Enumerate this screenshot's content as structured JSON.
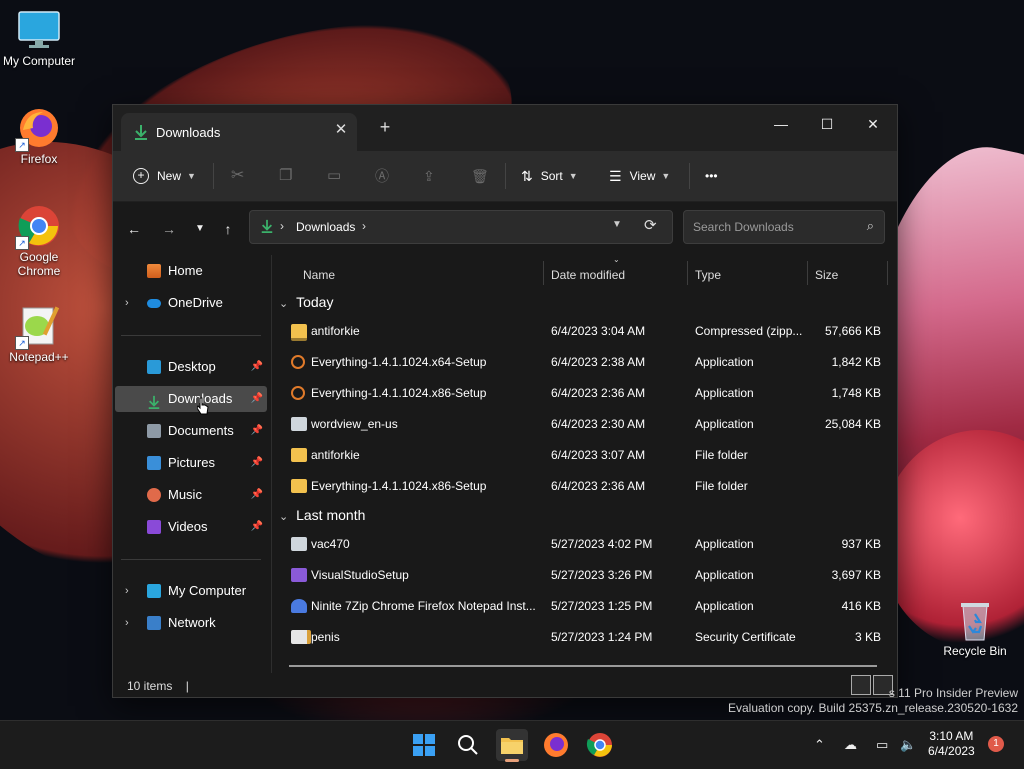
{
  "desktop": {
    "icons": [
      {
        "label": "My Computer"
      },
      {
        "label": "Firefox"
      },
      {
        "label": "Google Chrome"
      },
      {
        "label": "Notepad++"
      },
      {
        "label": "Recycle Bin"
      }
    ],
    "watermark_line1": "s 11 Pro Insider Preview",
    "watermark_line2": "Evaluation copy. Build 25375.zn_release.230520-1632"
  },
  "window": {
    "tab_title": "Downloads",
    "tab_close": "✕",
    "new_tab": "+",
    "controls": {
      "minimize": "—",
      "maximize": "☐",
      "close": "✕"
    },
    "commandbar": {
      "new_label": "New",
      "sort_label": "Sort",
      "view_label": "View",
      "more_label": "•••"
    },
    "address": {
      "path": "Downloads",
      "search_placeholder": "Search Downloads"
    },
    "sidebar": {
      "home": "Home",
      "onedrive": "OneDrive",
      "desktop": "Desktop",
      "downloads": "Downloads",
      "documents": "Documents",
      "pictures": "Pictures",
      "music": "Music",
      "videos": "Videos",
      "my_computer": "My Computer",
      "network": "Network"
    },
    "columns": {
      "name": "Name",
      "date": "Date modified",
      "type": "Type",
      "size": "Size"
    },
    "groups": {
      "today": "Today",
      "last_month": "Last month"
    },
    "files_today": [
      {
        "name": "antiforkie",
        "date": "6/4/2023 3:04 AM",
        "type": "Compressed (zipp...",
        "size": "57,666 KB",
        "icon": "zip-folder-icon"
      },
      {
        "name": "Everything-1.4.1.1024.x64-Setup",
        "date": "6/4/2023 2:38 AM",
        "type": "Application",
        "size": "1,842 KB",
        "icon": "everything-app-icon"
      },
      {
        "name": "Everything-1.4.1.1024.x86-Setup",
        "date": "6/4/2023 2:36 AM",
        "type": "Application",
        "size": "1,748 KB",
        "icon": "everything-app-icon"
      },
      {
        "name": "wordview_en-us",
        "date": "6/4/2023 2:30 AM",
        "type": "Application",
        "size": "25,084 KB",
        "icon": "installer-icon"
      },
      {
        "name": "antiforkie",
        "date": "6/4/2023 3:07 AM",
        "type": "File folder",
        "size": "",
        "icon": "folder-icon"
      },
      {
        "name": "Everything-1.4.1.1024.x86-Setup",
        "date": "6/4/2023 2:36 AM",
        "type": "File folder",
        "size": "",
        "icon": "folder-icon"
      }
    ],
    "files_last_month": [
      {
        "name": "vac470",
        "date": "5/27/2023 4:02 PM",
        "type": "Application",
        "size": "937 KB",
        "icon": "installer-icon"
      },
      {
        "name": "VisualStudioSetup",
        "date": "5/27/2023 3:26 PM",
        "type": "Application",
        "size": "3,697 KB",
        "icon": "visual-studio-icon"
      },
      {
        "name": "Ninite 7Zip Chrome Firefox Notepad Inst...",
        "date": "5/27/2023 1:25 PM",
        "type": "Application",
        "size": "416 KB",
        "icon": "ninite-icon"
      },
      {
        "name": "penis",
        "date": "5/27/2023 1:24 PM",
        "type": "Security Certificate",
        "size": "3 KB",
        "icon": "certificate-icon"
      }
    ],
    "status": {
      "count": "10 items",
      "caret": "|"
    }
  },
  "taskbar": {
    "time": "3:10 AM",
    "date": "6/4/2023",
    "notification_count": "1"
  },
  "colors": {
    "accent": "#3bb26b",
    "folder": "#f2c14e",
    "window_bg": "#191919"
  }
}
